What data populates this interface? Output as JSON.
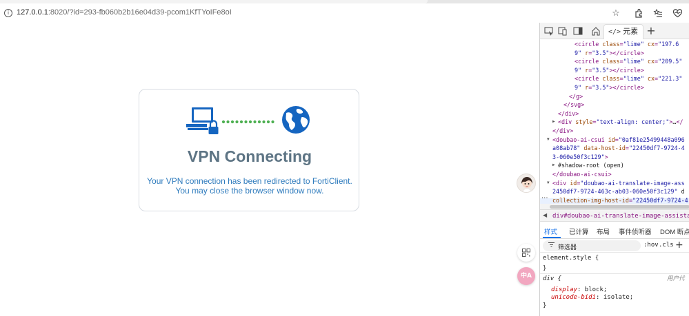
{
  "browser": {
    "url_host": "127.0.0.1",
    "url_rest": ":8020/?id=293-fb060b2b16e04d39-pcom1KfTYoIFe8oI",
    "icons": [
      "info-icon",
      "star-icon",
      "extensions-icon",
      "favorites-icon",
      "collections-icon",
      "heart-icon"
    ]
  },
  "card": {
    "title": "VPN Connecting",
    "message_line1": "Your VPN connection has been redirected to FortiClient.",
    "message_line2": "You may close the browser window now.",
    "icons": [
      "computer-lock-icon",
      "globe-icon"
    ],
    "colors": {
      "title": "#5d7484",
      "message": "#2e7bbd",
      "icon_blue": "#1565c0",
      "dots": "#4caf50"
    }
  },
  "devtools": {
    "active_tab": "元素",
    "active_tab_glyph": "</>",
    "dom_lines": [
      {
        "indent": 5,
        "parts": [
          [
            "tag",
            "<circle "
          ],
          [
            "an",
            "class"
          ],
          [
            "tag",
            "="
          ],
          [
            "av",
            "\"lime\""
          ],
          [
            "tx",
            " "
          ],
          [
            "an",
            "cx"
          ],
          [
            "tag",
            "="
          ],
          [
            "av",
            "\"197.6"
          ]
        ]
      },
      {
        "indent": 5,
        "parts": [
          [
            "av",
            "9\""
          ],
          [
            "tx",
            " "
          ],
          [
            "an",
            "r"
          ],
          [
            "tag",
            "="
          ],
          [
            "av",
            "\"3.5\""
          ],
          [
            "tag",
            "></circle>"
          ]
        ]
      },
      {
        "indent": 5,
        "parts": [
          [
            "tag",
            "<circle "
          ],
          [
            "an",
            "class"
          ],
          [
            "tag",
            "="
          ],
          [
            "av",
            "\"lime\""
          ],
          [
            "tx",
            " "
          ],
          [
            "an",
            "cx"
          ],
          [
            "tag",
            "="
          ],
          [
            "av",
            "\"209.5\""
          ]
        ]
      },
      {
        "indent": 5,
        "parts": [
          [
            "av",
            "9\""
          ],
          [
            "tx",
            " "
          ],
          [
            "an",
            "r"
          ],
          [
            "tag",
            "="
          ],
          [
            "av",
            "\"3.5\""
          ],
          [
            "tag",
            "></circle>"
          ]
        ]
      },
      {
        "indent": 5,
        "parts": [
          [
            "tag",
            "<circle "
          ],
          [
            "an",
            "class"
          ],
          [
            "tag",
            "="
          ],
          [
            "av",
            "\"lime\""
          ],
          [
            "tx",
            " "
          ],
          [
            "an",
            "cx"
          ],
          [
            "tag",
            "="
          ],
          [
            "av",
            "\"221.3\""
          ]
        ]
      },
      {
        "indent": 5,
        "parts": [
          [
            "av",
            "9\""
          ],
          [
            "tx",
            " "
          ],
          [
            "an",
            "r"
          ],
          [
            "tag",
            "="
          ],
          [
            "av",
            "\"3.5\""
          ],
          [
            "tag",
            "></circle>"
          ]
        ]
      },
      {
        "indent": 4,
        "parts": [
          [
            "tag",
            "</g>"
          ]
        ]
      },
      {
        "indent": 3,
        "parts": [
          [
            "tag",
            "</svg>"
          ]
        ]
      },
      {
        "indent": 2,
        "parts": [
          [
            "tag",
            "</div>"
          ]
        ]
      },
      {
        "indent": 2,
        "arrow": "▶",
        "parts": [
          [
            "tag",
            "<div "
          ],
          [
            "an",
            "style"
          ],
          [
            "tag",
            "="
          ],
          [
            "av",
            "\"text-align: center;\""
          ],
          [
            "tag",
            ">"
          ],
          [
            "tx",
            "…"
          ],
          [
            "tag",
            "</"
          ]
        ]
      },
      {
        "indent": 1,
        "parts": [
          [
            "tag",
            "</div>"
          ]
        ]
      },
      {
        "indent": 1,
        "arrow": "▼",
        "parts": [
          [
            "tag",
            "<doubao-ai-csui "
          ],
          [
            "an",
            "id"
          ],
          [
            "tag",
            "="
          ],
          [
            "av",
            "\"0af81e25499448a096"
          ]
        ]
      },
      {
        "indent": 1,
        "parts": [
          [
            "av",
            "a08ab78\""
          ],
          [
            "tx",
            " "
          ],
          [
            "an",
            "data-host-id"
          ],
          [
            "tag",
            "="
          ],
          [
            "av",
            "\"22450df7-9724-4"
          ]
        ]
      },
      {
        "indent": 1,
        "parts": [
          [
            "av",
            "3-060e50f3c129\""
          ],
          [
            "tag",
            ">"
          ]
        ]
      },
      {
        "indent": 2,
        "arrow": "▶",
        "parts": [
          [
            "tx",
            "#shadow-root (open)"
          ]
        ]
      },
      {
        "indent": 1,
        "parts": [
          [
            "tag",
            "</doubao-ai-csui>"
          ]
        ]
      },
      {
        "indent": 1,
        "arrow": "▼",
        "parts": [
          [
            "tag",
            "<div "
          ],
          [
            "an",
            "id"
          ],
          [
            "tag",
            "="
          ],
          [
            "av",
            "\"doubao-ai-translate-image-ass"
          ]
        ]
      },
      {
        "indent": 1,
        "parts": [
          [
            "av",
            "2450df7-9724-463c-ab03-060e50f3c129\""
          ],
          [
            "tx",
            " d"
          ]
        ]
      },
      {
        "indent": 1,
        "parts": [
          [
            "an",
            "collection-img-host-id"
          ],
          [
            "tag",
            "="
          ],
          [
            "av",
            "\"22450df7-9724-4"
          ]
        ]
      }
    ],
    "dom_dots": "...",
    "breadcrumb": "div#doubao-ai-translate-image-assistant2245",
    "styles_tabs": [
      "样式",
      "已计算",
      "布局",
      "事件侦听器",
      "DOM 断点"
    ],
    "filter_placeholder": "筛选器",
    "hov": ":hov",
    "cls": ".cls",
    "rules": {
      "element_style": "element.style {",
      "close1": "}",
      "div_selector": "div {",
      "ua_label": "用户代",
      "prop1": "display",
      "val1": "block;",
      "prop2": "unicode-bidi",
      "val2": "isolate;",
      "close2": "}"
    }
  },
  "floating": {
    "avatar": "assistant-avatar",
    "buttons": [
      "grid-icon",
      "translate-icon"
    ],
    "translate_label": "中A"
  }
}
